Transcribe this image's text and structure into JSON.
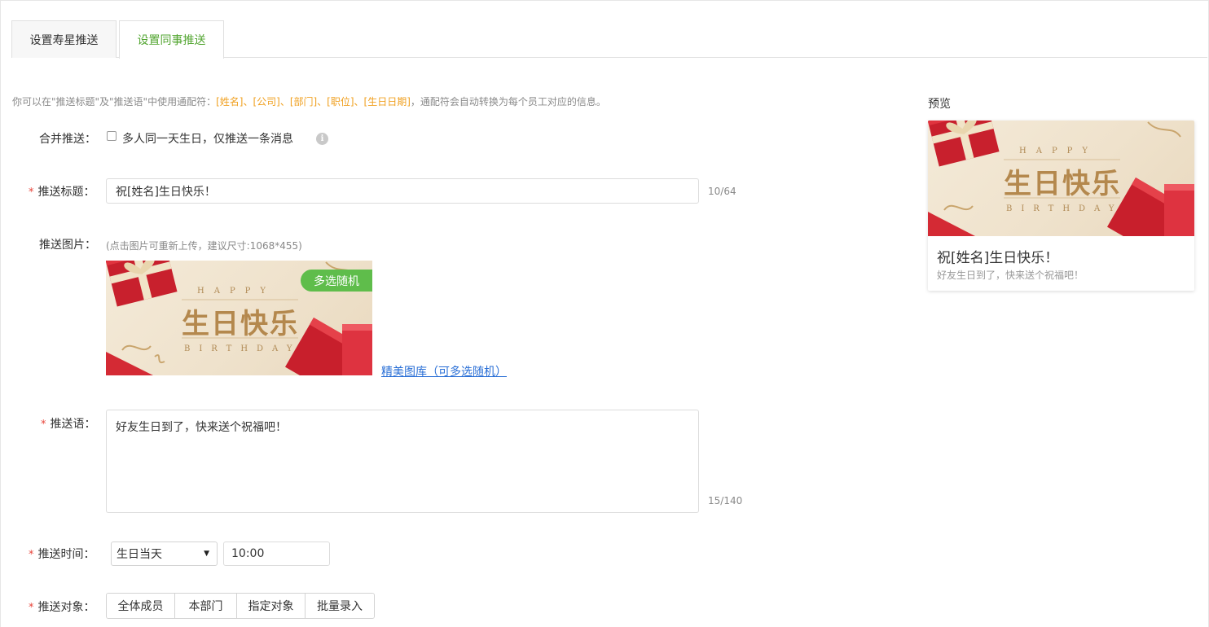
{
  "tabs": [
    {
      "label": "设置寿星推送",
      "active": false
    },
    {
      "label": "设置同事推送",
      "active": true
    }
  ],
  "tip": {
    "prefix": "你可以在\"推送标题\"及\"推送语\"中使用通配符：",
    "wildcards": "[姓名]、[公司]、[部门]、[职位]、[生日日期]",
    "suffix": "，通配符会自动转换为每个员工对应的信息。"
  },
  "form": {
    "merge": {
      "label": "合并推送：",
      "checked": false,
      "text": "多人同一天生日，仅推送一条消息",
      "info_icon": "info-icon"
    },
    "title": {
      "label": "推送标题：",
      "value": "祝[姓名]生日快乐！",
      "counter": "10/64"
    },
    "image": {
      "label": "推送图片：",
      "hint": "(点击图片可重新上传，建议尺寸:1068*455)",
      "banner": {
        "top": "HAPPY",
        "main": "生日快乐",
        "bottom": "BIRTHDAY"
      },
      "badge": "多选随机",
      "gallery_link": "精美图库（可多选随机）"
    },
    "message": {
      "label": "推送语：",
      "value": "好友生日到了，快来送个祝福吧！",
      "counter": "15/140"
    },
    "time": {
      "label": "推送时间：",
      "day_option": "生日当天",
      "time_value": "10:00"
    },
    "target": {
      "label": "推送对象：",
      "options": [
        "全体成员",
        "本部门",
        "指定对象",
        "批量录入"
      ]
    }
  },
  "preview": {
    "heading": "预览",
    "card_title": "祝[姓名]生日快乐！",
    "card_message": "好友生日到了，快来送个祝福吧！"
  },
  "colors": {
    "accent_green": "#52a530",
    "badge_green": "#5fbd4b",
    "wildcard_orange": "#f0a020",
    "link_blue": "#2a6fd6",
    "required_red": "#e8443a"
  }
}
